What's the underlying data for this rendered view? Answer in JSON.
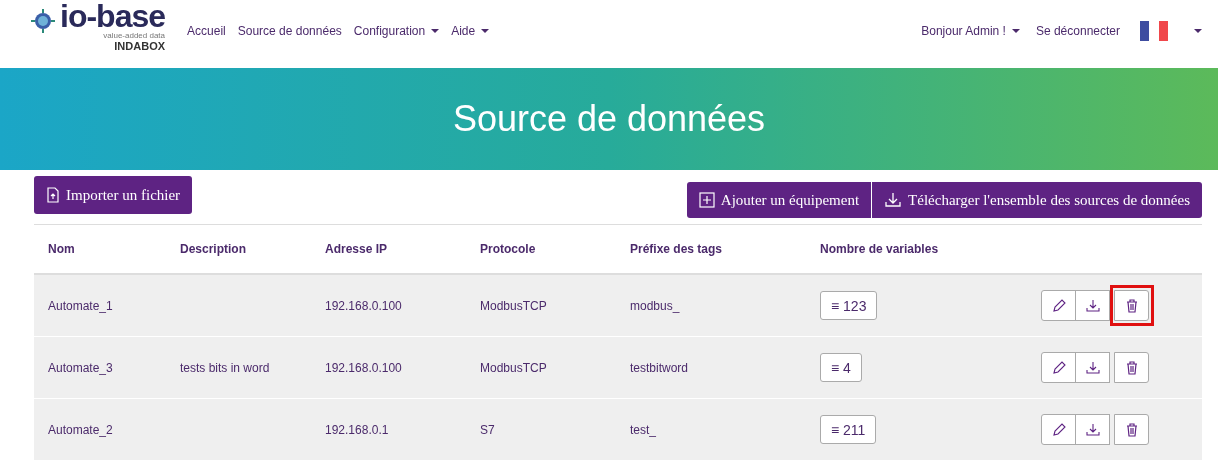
{
  "brand": {
    "name": "io-base",
    "tagline": "value-added data",
    "product": "INDABOX"
  },
  "nav": [
    {
      "label": "Accueil",
      "dropdown": false
    },
    {
      "label": "Source de données",
      "dropdown": false
    },
    {
      "label": "Configuration",
      "dropdown": true
    },
    {
      "label": "Aide",
      "dropdown": true
    }
  ],
  "user_menu": {
    "greeting": "Bonjour Admin !",
    "logout": "Se déconnecter"
  },
  "banner": {
    "title": "Source de données"
  },
  "actions": {
    "import": "Importer un fichier",
    "add": "Ajouter un équipement",
    "download_all": "Télécharger l'ensemble des sources de données"
  },
  "table": {
    "columns": [
      "Nom",
      "Description",
      "Adresse IP",
      "Protocole",
      "Préfixe des tags",
      "Nombre de variables"
    ],
    "rows": [
      {
        "name": "Automate_1",
        "description": "",
        "ip": "192.168.0.100",
        "protocol": "ModbusTCP",
        "prefix": "modbus_",
        "variables": "≡ 123",
        "delete_highlighted": true
      },
      {
        "name": "Automate_3",
        "description": "tests bits in word",
        "ip": "192.168.0.100",
        "protocol": "ModbusTCP",
        "prefix": "testbitword",
        "variables": "≡ 4",
        "delete_highlighted": false
      },
      {
        "name": "Automate_2",
        "description": "",
        "ip": "192.168.0.1",
        "protocol": "S7",
        "prefix": "test_",
        "variables": "≡ 211",
        "delete_highlighted": false
      }
    ]
  }
}
